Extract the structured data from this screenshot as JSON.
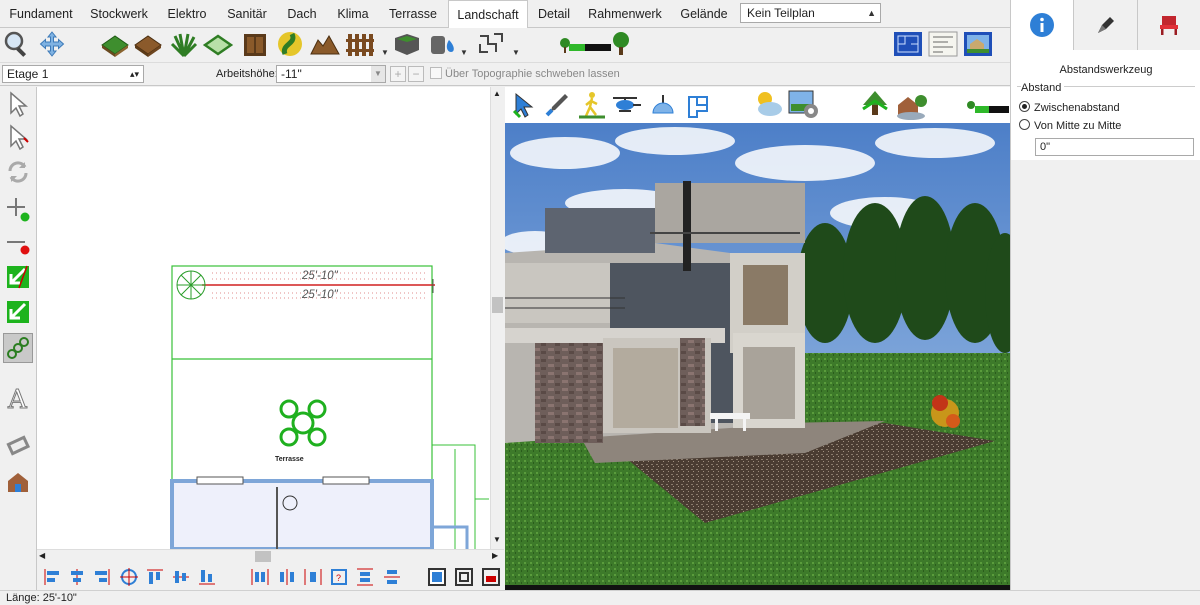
{
  "tabs": [
    "Fundament",
    "Stockwerk",
    "Elektro",
    "Sanitär",
    "Dach",
    "Klima",
    "Terrasse",
    "Landschaft",
    "Detail",
    "Rahmenwerk",
    "Gelände"
  ],
  "active_tab": "Landschaft",
  "teilplan_select": "Kein Teilplan",
  "toolbar": {
    "icons": [
      "magnifier-icon",
      "pan-icon",
      "grass-area-icon",
      "soil-area-icon",
      "plant-icon",
      "bed-outline-icon",
      "gate-icon",
      "path-icon",
      "terrain-hill-icon",
      "fence-icon",
      "planter-icon",
      "water-tank-icon",
      "sprinkler-path-icon",
      "plant-size-slider-icon"
    ]
  },
  "row2": {
    "floor_select": "Etage 1",
    "height_label": "Arbeitshöhe:",
    "height_value": "-11\"",
    "float_label": "Über Topographie schweben lassen"
  },
  "right_panel": {
    "tabs": [
      "info-icon",
      "pen-icon",
      "chair-icon"
    ],
    "title": "Abstandswerkzeug",
    "group_label": "Abstand",
    "option1": "Zwischenabstand",
    "option2": "Von Mitte zu Mitte",
    "value": "0\""
  },
  "plan": {
    "dim_top": "25'-10\"",
    "dim_bottom": "25'-10\"",
    "terrasse_label": "Terrasse"
  },
  "status": {
    "text": "Länge:  25'-10\""
  }
}
